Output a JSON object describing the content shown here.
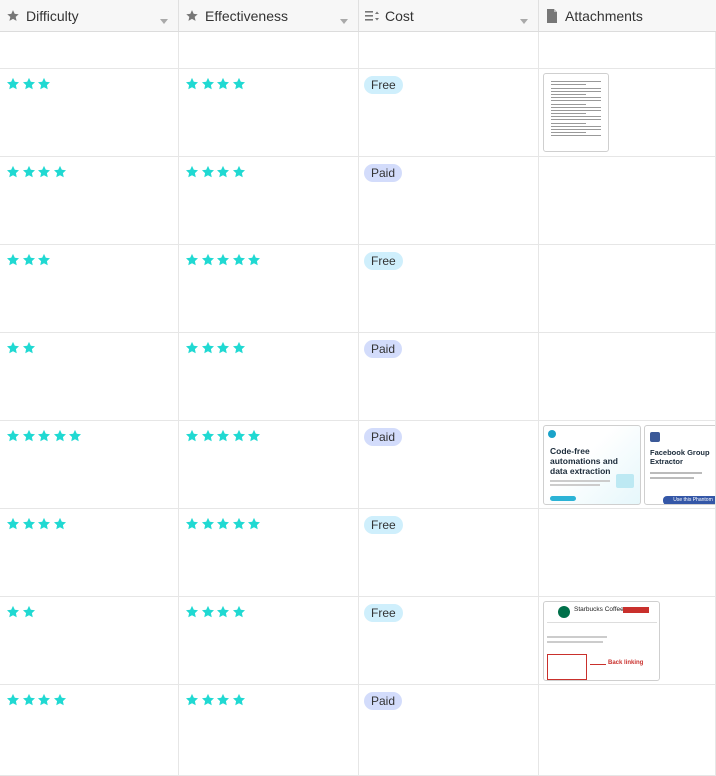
{
  "columns": [
    {
      "label": "Difficulty",
      "icon": "star-field-icon"
    },
    {
      "label": "Effectiveness",
      "icon": "star-field-icon"
    },
    {
      "label": "Cost",
      "icon": "single-select-icon"
    },
    {
      "label": "Attachments",
      "icon": "document-icon"
    }
  ],
  "colors": {
    "star": "#20d9d2",
    "free_bg": "#cfeffc",
    "paid_bg": "#d3dcfb",
    "header_bg": "#f7f7f7"
  },
  "rows": [
    {
      "difficulty": 3,
      "effectiveness": 4,
      "cost": "Free",
      "attachments": [
        "spreadsheet-document"
      ]
    },
    {
      "difficulty": 4,
      "effectiveness": 4,
      "cost": "Paid",
      "attachments": []
    },
    {
      "difficulty": 3,
      "effectiveness": 5,
      "cost": "Free",
      "attachments": []
    },
    {
      "difficulty": 2,
      "effectiveness": 4,
      "cost": "Paid",
      "attachments": []
    },
    {
      "difficulty": 5,
      "effectiveness": 5,
      "cost": "Paid",
      "attachments": [
        "phantombuster-screenshot",
        "facebook-group-extractor"
      ]
    },
    {
      "difficulty": 4,
      "effectiveness": 5,
      "cost": "Free",
      "attachments": []
    },
    {
      "difficulty": 2,
      "effectiveness": 4,
      "cost": "Free",
      "attachments": [
        "starbucks-back-linking"
      ]
    },
    {
      "difficulty": 4,
      "effectiveness": 4,
      "cost": "Paid",
      "attachments": []
    }
  ],
  "attachment_text": {
    "phantom_headline_1": "Code-free",
    "phantom_headline_2": "automations and",
    "phantom_headline_3": "data extraction",
    "fb_title_1": "Facebook Group",
    "fb_title_2": "Extractor",
    "fb_button": "Use this Phantom",
    "starbucks_name": "Starbucks Coffee",
    "back_linking": "Back linking"
  }
}
